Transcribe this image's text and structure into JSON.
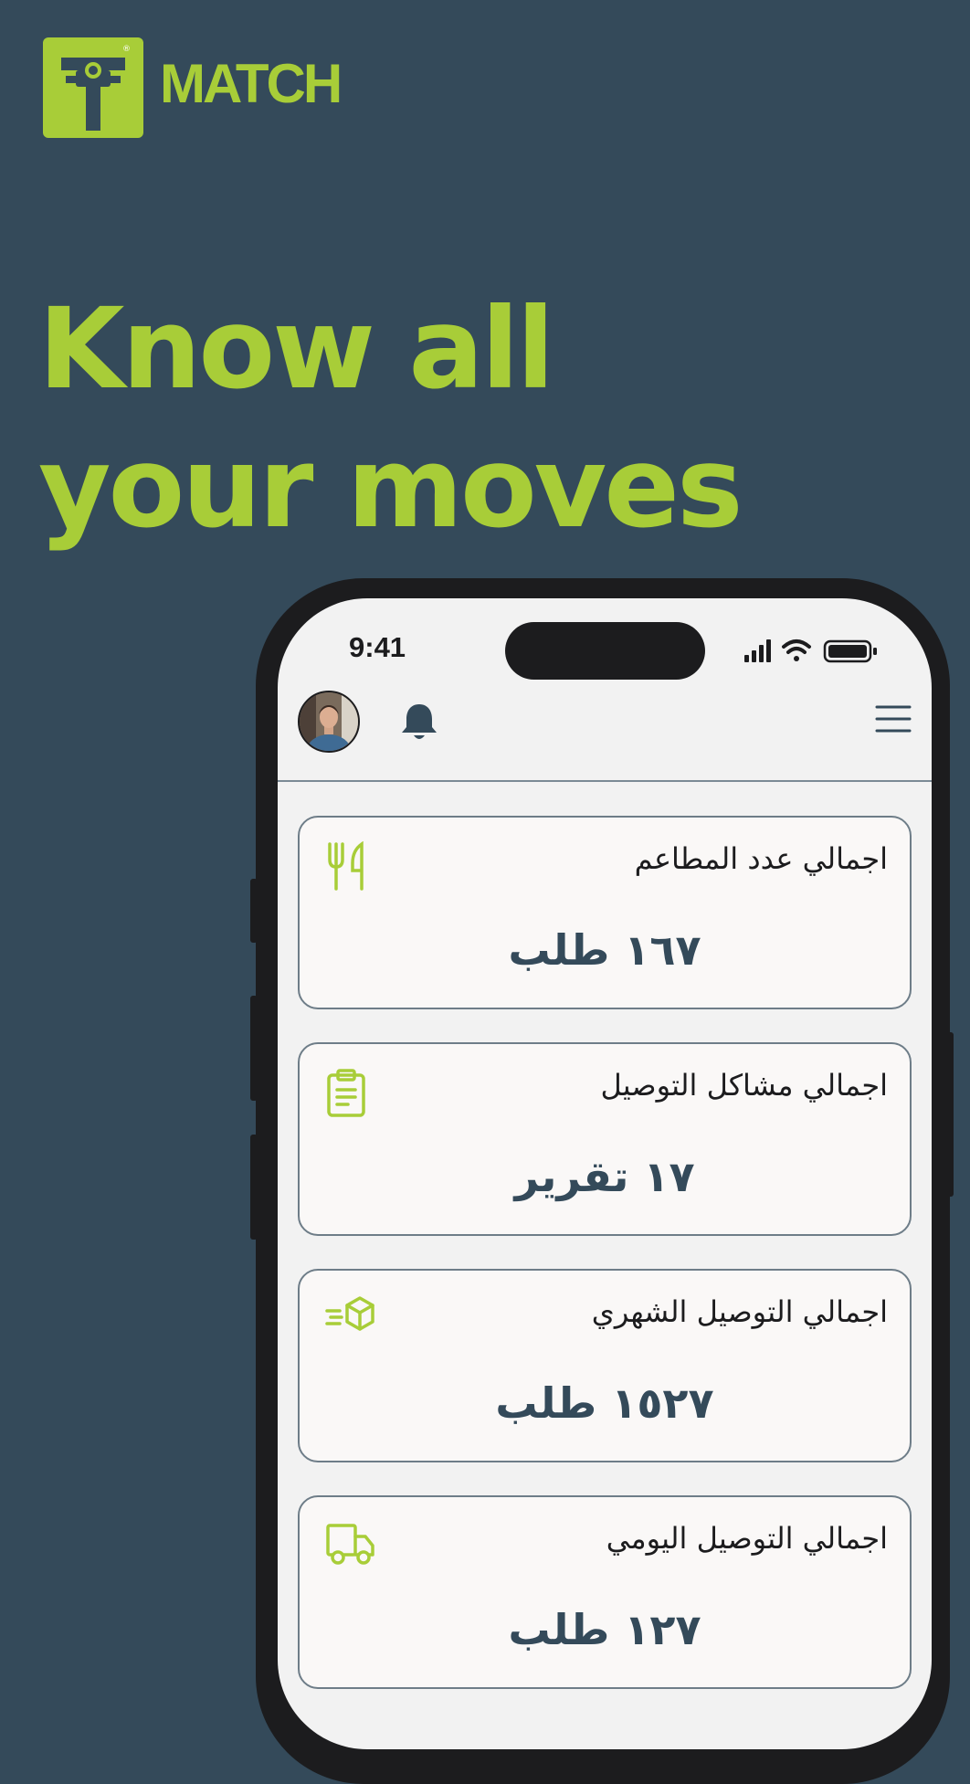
{
  "brand": {
    "name": "MATCH",
    "registered_mark": "®",
    "accent": "#a8cd38",
    "background": "#344a5a"
  },
  "headline": "Know all your moves",
  "status_bar": {
    "time": "9:41"
  },
  "header": {
    "avatar": "avatar-photo",
    "notification_icon": "bell-icon",
    "menu_icon": "hamburger-menu-icon"
  },
  "cards": [
    {
      "title": "اجمالي عدد المطاعم",
      "value": "١٦٧ طلب",
      "icon": "utensils-icon"
    },
    {
      "title": "اجمالي مشاكل التوصيل",
      "value": "١٧ تقرير",
      "icon": "clipboard-icon"
    },
    {
      "title": "اجمالي التوصيل الشهري",
      "value": "١٥٢٧ طلب",
      "icon": "fast-box-icon"
    },
    {
      "title": "اجمالي التوصيل اليومي",
      "value": "١٢٧ طلب",
      "icon": "truck-icon"
    }
  ]
}
